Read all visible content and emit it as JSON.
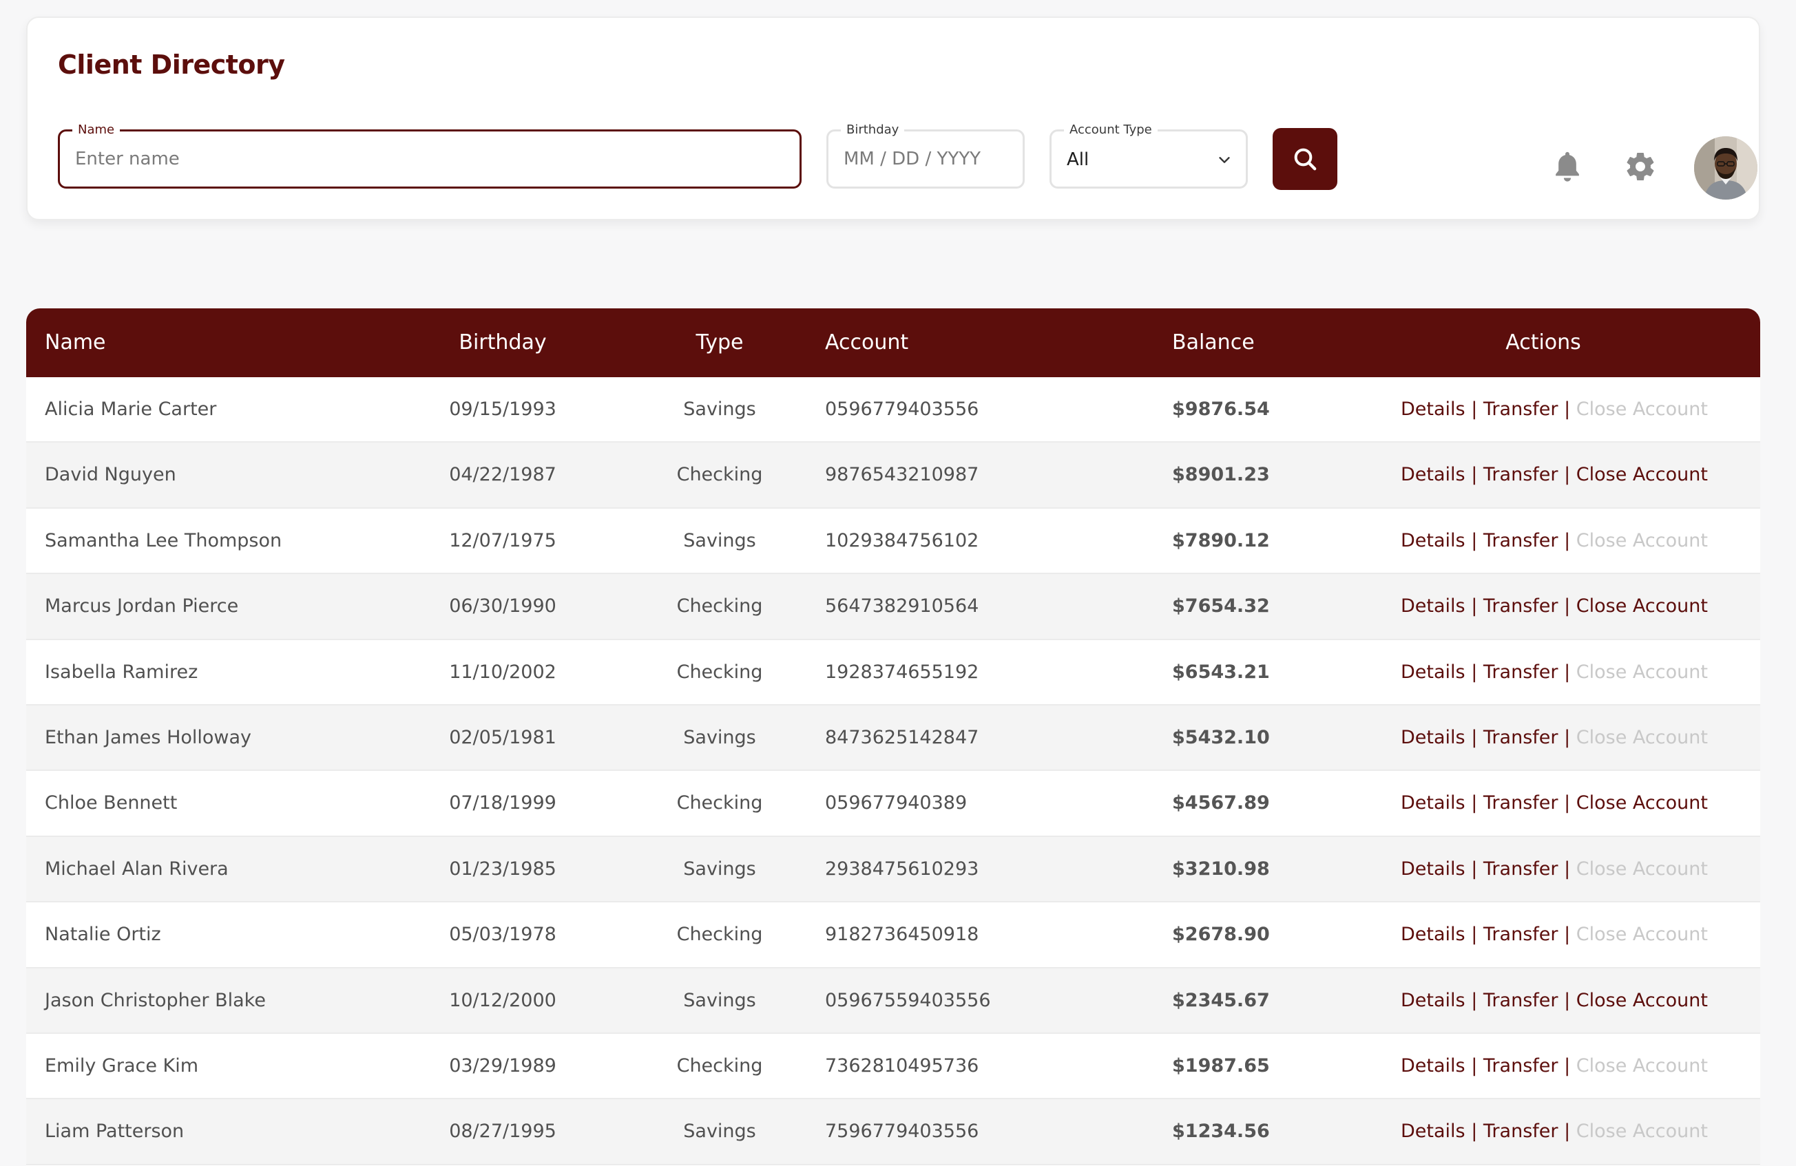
{
  "header": {
    "title": "Client Directory",
    "name_field": {
      "label": "Name",
      "placeholder": "Enter name",
      "value": ""
    },
    "birthday_field": {
      "label": "Birthday",
      "placeholder": "MM / DD / YYYY",
      "value": ""
    },
    "account_type_field": {
      "label": "Account Type",
      "value": "All"
    },
    "icons": {
      "search": "search-icon",
      "notifications": "bell-icon",
      "settings": "gear-icon",
      "avatar": "user-avatar"
    }
  },
  "colors": {
    "brand": "#5c0e0c",
    "disabled_action": "#c8c8c8",
    "row_alt": "#f4f4f4"
  },
  "table": {
    "columns": [
      "Name",
      "Birthday",
      "Type",
      "Account",
      "Balance",
      "Actions"
    ],
    "action_labels": {
      "details": "Details",
      "transfer": "Transfer",
      "close": "Close Account",
      "separator": "|"
    },
    "rows": [
      {
        "name": "Alicia Marie Carter",
        "birthday": "09/15/1993",
        "type": "Savings",
        "account": "0596779403556",
        "balance": "$9876.54",
        "close_enabled": false
      },
      {
        "name": "David Nguyen",
        "birthday": "04/22/1987",
        "type": "Checking",
        "account": "9876543210987",
        "balance": "$8901.23",
        "close_enabled": true
      },
      {
        "name": "Samantha Lee Thompson",
        "birthday": "12/07/1975",
        "type": "Savings",
        "account": "1029384756102",
        "balance": "$7890.12",
        "close_enabled": false
      },
      {
        "name": "Marcus Jordan Pierce",
        "birthday": "06/30/1990",
        "type": "Checking",
        "account": "5647382910564",
        "balance": "$7654.32",
        "close_enabled": true
      },
      {
        "name": "Isabella Ramirez",
        "birthday": "11/10/2002",
        "type": "Checking",
        "account": "1928374655192",
        "balance": "$6543.21",
        "close_enabled": false
      },
      {
        "name": "Ethan James Holloway",
        "birthday": "02/05/1981",
        "type": "Savings",
        "account": "8473625142847",
        "balance": "$5432.10",
        "close_enabled": false
      },
      {
        "name": "Chloe Bennett",
        "birthday": "07/18/1999",
        "type": "Checking",
        "account": "059677940389",
        "balance": "$4567.89",
        "close_enabled": true
      },
      {
        "name": "Michael Alan Rivera",
        "birthday": "01/23/1985",
        "type": "Savings",
        "account": "2938475610293",
        "balance": "$3210.98",
        "close_enabled": false
      },
      {
        "name": "Natalie Ortiz",
        "birthday": "05/03/1978",
        "type": "Checking",
        "account": "9182736450918",
        "balance": "$2678.90",
        "close_enabled": false
      },
      {
        "name": "Jason Christopher Blake",
        "birthday": "10/12/2000",
        "type": "Savings",
        "account": "05967559403556",
        "balance": "$2345.67",
        "close_enabled": true
      },
      {
        "name": "Emily Grace Kim",
        "birthday": "03/29/1989",
        "type": "Checking",
        "account": "7362810495736",
        "balance": "$1987.65",
        "close_enabled": false
      },
      {
        "name": "Liam Patterson",
        "birthday": "08/27/1995",
        "type": "Savings",
        "account": "7596779403556",
        "balance": "$1234.56",
        "close_enabled": false
      }
    ]
  }
}
